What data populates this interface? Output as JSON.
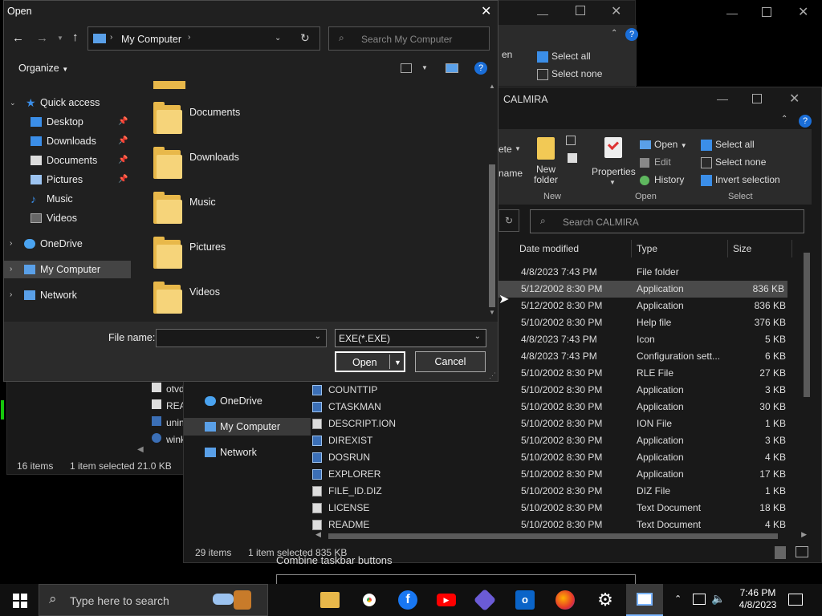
{
  "win1": {
    "ribbon_select_all": "Select all",
    "ribbon_select_none": "Select none",
    "ribbon_partial": "en",
    "files_partial": [
      "otvd",
      "REAI",
      "unin",
      "wink"
    ],
    "status_items": "16 items",
    "status_selected": "1 item selected  21.0 KB"
  },
  "win2": {
    "title": "CALMIRA",
    "ribbon": {
      "delete_partial": "ete",
      "rename_partial": "name",
      "new_folder": "New folder",
      "group_new": "New",
      "properties": "Properties",
      "open": "Open",
      "edit": "Edit",
      "history": "History",
      "group_open": "Open",
      "select_all": "Select all",
      "select_none": "Select none",
      "invert_selection": "Invert selection",
      "group_select": "Select"
    },
    "search_placeholder": "Search CALMIRA",
    "columns": [
      "Date modified",
      "Type",
      "Size"
    ],
    "nav": [
      "OneDrive",
      "My Computer",
      "Network"
    ],
    "rows": [
      {
        "name": "",
        "date": "4/8/2023 7:43 PM",
        "type": "File folder",
        "size": ""
      },
      {
        "name": "",
        "date": "5/12/2002 8:30 PM",
        "type": "Application",
        "size": "836 KB"
      },
      {
        "name": "",
        "date": "5/12/2002 8:30 PM",
        "type": "Application",
        "size": "836 KB"
      },
      {
        "name": "",
        "date": "5/10/2002 8:30 PM",
        "type": "Help file",
        "size": "376 KB"
      },
      {
        "name": "",
        "date": "4/8/2023 7:43 PM",
        "type": "Icon",
        "size": "5 KB"
      },
      {
        "name": "",
        "date": "4/8/2023 7:43 PM",
        "type": "Configuration sett...",
        "size": "6 KB"
      },
      {
        "name": "",
        "date": "5/10/2002 8:30 PM",
        "type": "RLE File",
        "size": "27 KB"
      },
      {
        "name": "COUNTTIP",
        "date": "5/10/2002 8:30 PM",
        "type": "Application",
        "size": "3 KB"
      },
      {
        "name": "CTASKMAN",
        "date": "5/10/2002 8:30 PM",
        "type": "Application",
        "size": "30 KB"
      },
      {
        "name": "DESCRIPT.ION",
        "date": "5/10/2002 8:30 PM",
        "type": "ION File",
        "size": "1 KB"
      },
      {
        "name": "DIREXIST",
        "date": "5/10/2002 8:30 PM",
        "type": "Application",
        "size": "3 KB"
      },
      {
        "name": "DOSRUN",
        "date": "5/10/2002 8:30 PM",
        "type": "Application",
        "size": "4 KB"
      },
      {
        "name": "EXPLORER",
        "date": "5/10/2002 8:30 PM",
        "type": "Application",
        "size": "17 KB"
      },
      {
        "name": "FILE_ID.DIZ",
        "date": "5/10/2002 8:30 PM",
        "type": "DIZ File",
        "size": "1 KB"
      },
      {
        "name": "LICENSE",
        "date": "5/10/2002 8:30 PM",
        "type": "Text Document",
        "size": "18 KB"
      },
      {
        "name": "README",
        "date": "5/10/2002 8:30 PM",
        "type": "Text Document",
        "size": "4 KB"
      }
    ],
    "status_items": "29 items",
    "status_selected": "1 item selected  835 KB"
  },
  "bg_text": "Combine taskbar buttons",
  "dialog": {
    "title": "Open",
    "address": "My Computer",
    "search_placeholder": "Search My Computer",
    "organize": "Organize",
    "nav": {
      "quick_access": "Quick access",
      "desktop": "Desktop",
      "downloads": "Downloads",
      "documents": "Documents",
      "pictures": "Pictures",
      "music": "Music",
      "videos": "Videos",
      "onedrive": "OneDrive",
      "my_computer": "My Computer",
      "network": "Network"
    },
    "folders": [
      "Documents",
      "Downloads",
      "Music",
      "Pictures",
      "Videos"
    ],
    "file_name_label": "File name:",
    "file_name_value": "",
    "filter": "EXE(*.EXE)",
    "open_button": "Open",
    "cancel_button": "Cancel"
  },
  "taskbar": {
    "search_placeholder": "Type here to search",
    "time": "7:46 PM",
    "date": "4/8/2023"
  }
}
